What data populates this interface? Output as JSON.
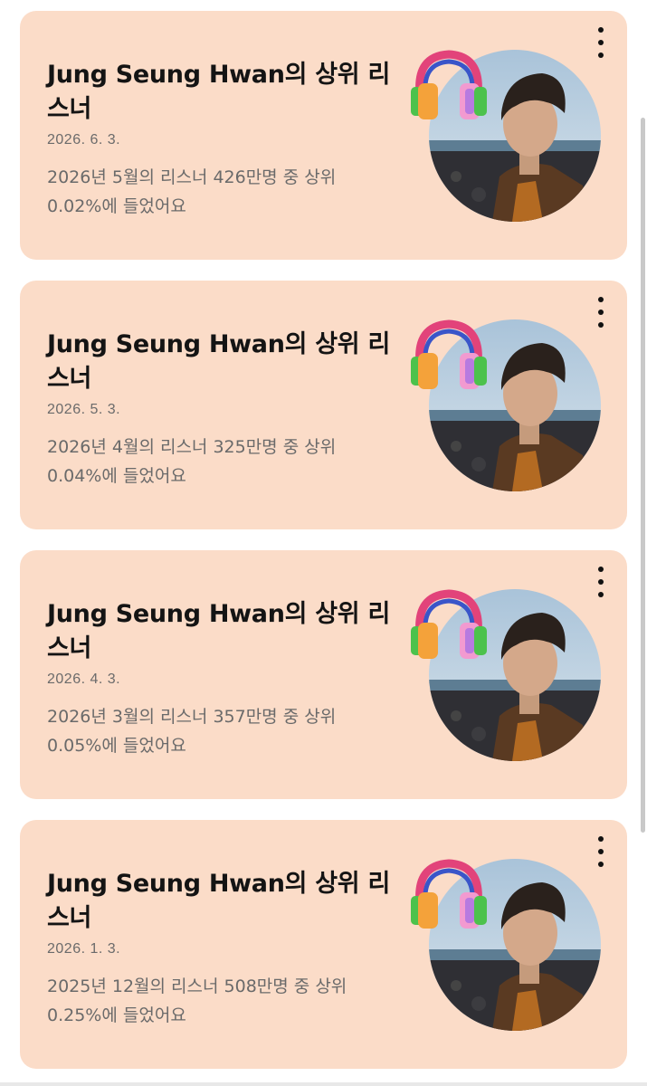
{
  "cards": [
    {
      "title": "Jung Seung Hwan의 상위 리스너",
      "date": "2026. 6. 3.",
      "description": "2026년 5월의 리스너 426만명 중 상위 0.02%에 들었어요",
      "menu_icon": "more-vertical-icon"
    },
    {
      "title": "Jung Seung Hwan의 상위 리스너",
      "date": "2026. 5. 3.",
      "description": "2026년 4월의 리스너 325만명 중 상위 0.04%에 들었어요",
      "menu_icon": "more-vertical-icon"
    },
    {
      "title": "Jung Seung Hwan의 상위 리스너",
      "date": "2026. 4. 3.",
      "description": "2026년 3월의 리스너 357만명 중 상위 0.05%에 들었어요",
      "menu_icon": "more-vertical-icon"
    },
    {
      "title": "Jung Seung Hwan의 상위 리스너",
      "date": "2026. 1. 3.",
      "description": "2025년 12월의 리스너 508만명 중 상위 0.25%에 들었어요",
      "menu_icon": "more-vertical-icon"
    }
  ],
  "colors": {
    "card_background": "#fbdcc8",
    "title_text": "#141414",
    "secondary_text": "#6a6a6a"
  }
}
